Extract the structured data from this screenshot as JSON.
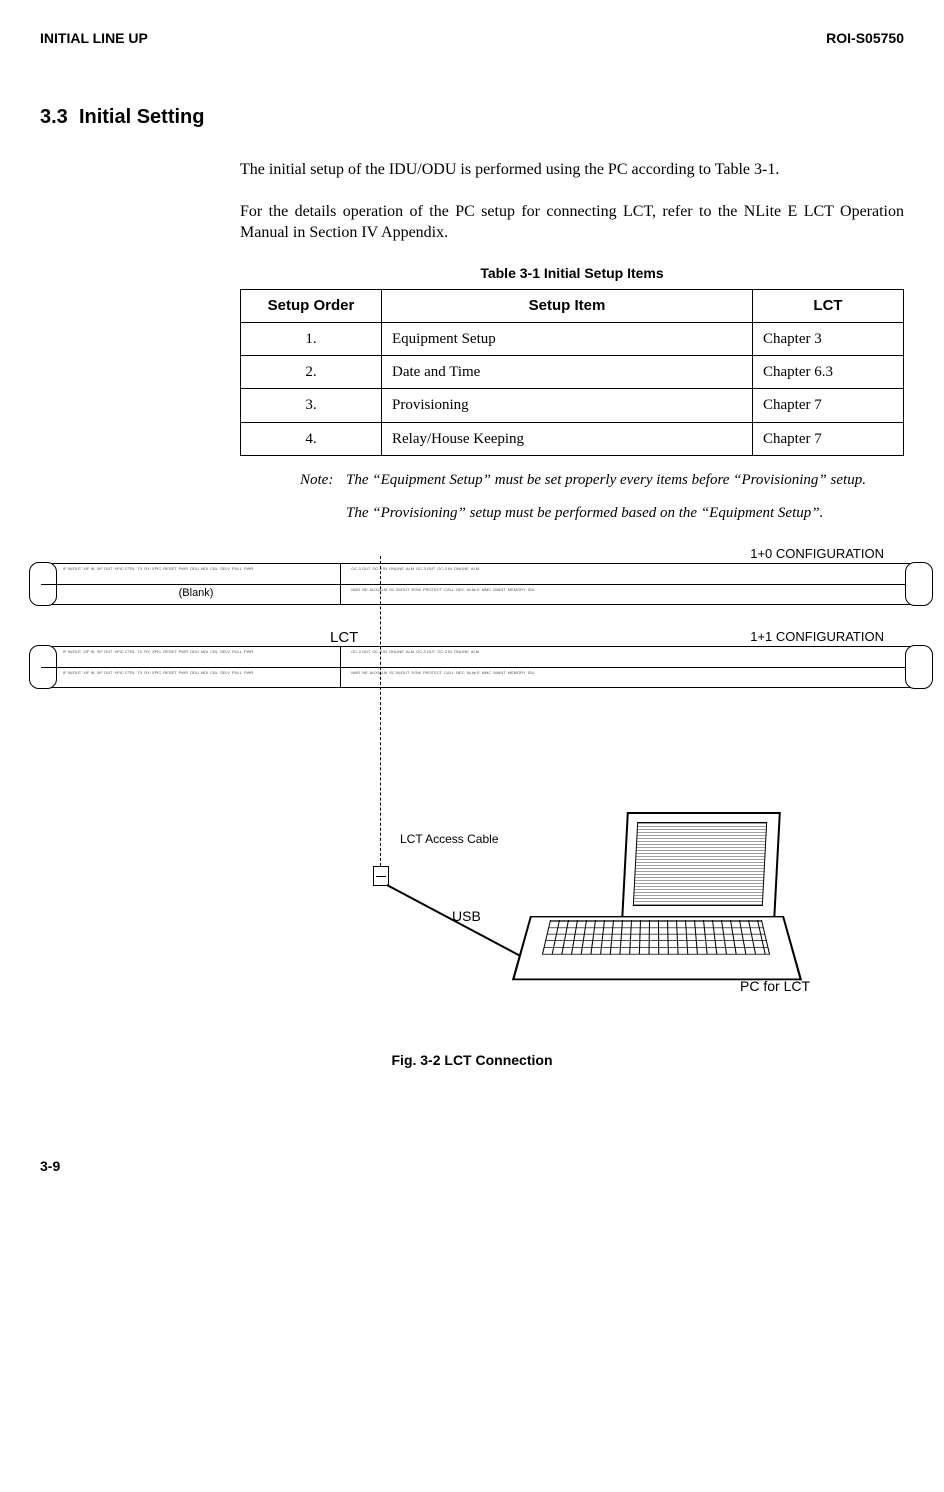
{
  "header": {
    "left": "INITIAL LINE UP",
    "right": "ROI-S05750"
  },
  "section": {
    "num": "3.3",
    "title": "Initial Setting"
  },
  "paragraphs": {
    "p1": "The initial setup of the IDU/ODU is performed using the PC according to Table 3-1.",
    "p2": "For the details operation of the PC setup for connecting LCT, refer to the NLite E  LCT Operation Manual in Section IV Appendix."
  },
  "table": {
    "caption": "Table 3-1  Initial Setup Items",
    "headers": {
      "c1": "Setup Order",
      "c2": "Setup Item",
      "c3": "LCT"
    },
    "rows": [
      {
        "order": "1.",
        "item": "Equipment Setup",
        "lct": "Chapter 3"
      },
      {
        "order": "2.",
        "item": "Date and Time",
        "lct": "Chapter 6.3"
      },
      {
        "order": "3.",
        "item": "Provisioning",
        "lct": "Chapter 7"
      },
      {
        "order": "4.",
        "item": "Relay/House Keeping",
        "lct": "Chapter 7"
      }
    ]
  },
  "note": {
    "label": "Note:",
    "t1": "The “Equipment Setup” must be set properly every items before “Provisioning” setup.",
    "t2": "The “Provisioning” setup must be performed based on the “Equipment Setup”."
  },
  "diagram": {
    "config10": "1+0 CONFIGURATION",
    "config11": "1+1 CONFIGURATION",
    "blank": "(Blank)",
    "lct": "LCT",
    "access_cable": "LCT Access Cable",
    "usb": "USB",
    "pc": "PC for LCT",
    "panel_labels": {
      "if": "IF IN/OUT",
      "xifin": "XIF IN",
      "xifout": "XIF OUT",
      "xpic_ctrl": "XPIC CTRL",
      "tx": "TX",
      "rx": "RX",
      "xpic": "XPIC",
      "reset": "RESET",
      "pwr": "PWR",
      "odu": "ODU",
      "mdi": "MDI",
      "cbl": "CBL",
      "selv": "SELV",
      "pull": "PULL",
      "oc3out": "OC-3 OUT",
      "oc3in": "OC-3 IN",
      "online": "ONLINE",
      "alm": "ALM",
      "nms": "NMS",
      "ne": "NE",
      "aux": "AUX/ALM",
      "sc": "SC IN/OUT",
      "eow": "EOW",
      "protect": "PROTECT",
      "call": "CALL",
      "mmc": "MMC",
      "nlite": "NLite E",
      "maint": "MAINT",
      "memory": "MEMORY",
      "idu": "IDU",
      "nec": "NEC"
    }
  },
  "figure_caption": "Fig. 3-2  LCT Connection",
  "page_number": "3-9"
}
